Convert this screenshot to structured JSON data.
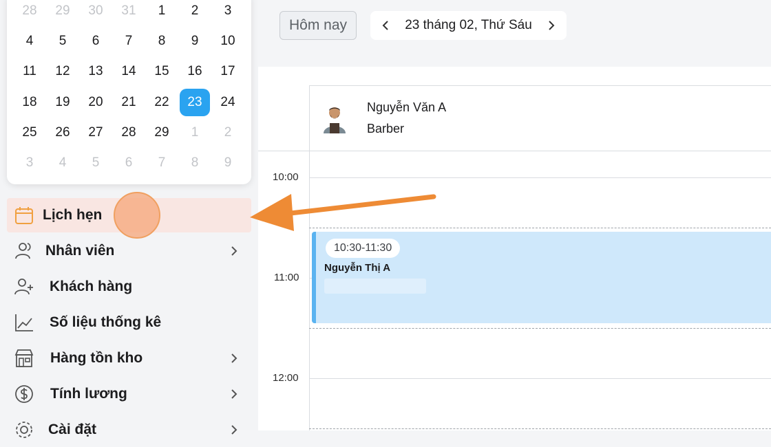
{
  "mini_calendar": {
    "rows": [
      [
        "28",
        "29",
        "30",
        "31",
        "1",
        "2",
        "3"
      ],
      [
        "4",
        "5",
        "6",
        "7",
        "8",
        "9",
        "10"
      ],
      [
        "11",
        "12",
        "13",
        "14",
        "15",
        "16",
        "17"
      ],
      [
        "18",
        "19",
        "20",
        "21",
        "22",
        "23",
        "24"
      ],
      [
        "25",
        "26",
        "27",
        "28",
        "29",
        "1",
        "2"
      ],
      [
        "3",
        "4",
        "5",
        "6",
        "7",
        "8",
        "9"
      ]
    ],
    "muted": [
      [
        true,
        true,
        true,
        true,
        false,
        false,
        false
      ],
      [
        false,
        false,
        false,
        false,
        false,
        false,
        false
      ],
      [
        false,
        false,
        false,
        false,
        false,
        false,
        false
      ],
      [
        false,
        false,
        false,
        false,
        false,
        false,
        false
      ],
      [
        false,
        false,
        false,
        false,
        false,
        true,
        true
      ],
      [
        true,
        true,
        true,
        true,
        true,
        true,
        true
      ]
    ],
    "selected_day": "23",
    "accent_color": "#2aa3f0"
  },
  "menu": {
    "items": [
      {
        "label": "Lịch hẹn",
        "icon": "calendar-icon",
        "active": true,
        "has_chevron": false
      },
      {
        "label": "Nhân viên",
        "icon": "users-icon",
        "active": false,
        "has_chevron": true
      },
      {
        "label": "Khách hàng",
        "icon": "user-plus-icon",
        "active": false,
        "has_chevron": false
      },
      {
        "label": "Số liệu thống kê",
        "icon": "chart-line-icon",
        "active": false,
        "has_chevron": false
      },
      {
        "label": "Hàng tồn kho",
        "icon": "store-icon",
        "active": false,
        "has_chevron": true
      },
      {
        "label": "Tính lương",
        "icon": "dollar-icon",
        "active": false,
        "has_chevron": true
      },
      {
        "label": "Cài đặt",
        "icon": "gear-icon",
        "active": false,
        "has_chevron": true
      }
    ]
  },
  "toolbar": {
    "today_label": "Hôm nay",
    "date_label": "23 tháng 02, Thứ Sáu"
  },
  "staff": {
    "name": "Nguyễn Văn A",
    "role": "Barber"
  },
  "time_slots": [
    "10:00",
    "11:00",
    "12:00"
  ],
  "appointment": {
    "time_range": "10:30-11:30",
    "client": "Nguyễn Thị A",
    "color": "#cfe8fb"
  },
  "annotation": {
    "highlight_color": "#f0a060"
  }
}
